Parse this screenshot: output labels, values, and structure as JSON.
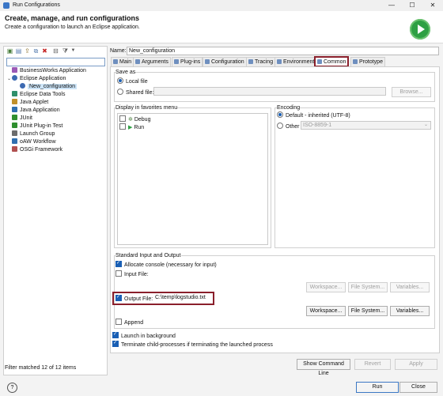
{
  "window": {
    "title": "Run Configurations",
    "minimize": "—",
    "maximize": "☐",
    "close": "✕"
  },
  "header": {
    "title": "Create, manage, and run configurations",
    "subtitle": "Create a configuration to launch an Eclipse application."
  },
  "tree": {
    "items": [
      {
        "label": "BusinessWorks Application",
        "color": "#9b59b6"
      },
      {
        "label": "Eclipse Application",
        "color": "#3d6ab2",
        "expanded": true
      },
      {
        "label": "New_configuration",
        "color": "#3d6ab2",
        "selected": true
      },
      {
        "label": "Eclipse Data Tools",
        "color": "#2f8f6a"
      },
      {
        "label": "Java Applet",
        "color": "#c0902a"
      },
      {
        "label": "Java Application",
        "color": "#2f6fb0"
      },
      {
        "label": "JUnit",
        "color": "#2f8f2f"
      },
      {
        "label": "JUnit Plug-in Test",
        "color": "#2f8f2f"
      },
      {
        "label": "Launch Group",
        "color": "#6c6c6c"
      },
      {
        "label": "oAW Workflow",
        "color": "#2f6fb0"
      },
      {
        "label": "OSGi Framework",
        "color": "#b05050"
      }
    ],
    "filter_status": "Filter matched 12 of 12 items"
  },
  "config": {
    "name_label": "Name:",
    "name_value": "New_configuration"
  },
  "tabs": [
    "Main",
    "Arguments",
    "Plug-ins",
    "Configuration",
    "Tracing",
    "Environment",
    "Common",
    "Prototype"
  ],
  "save_as": {
    "label": "Save as",
    "local": "Local file",
    "shared": "Shared file:",
    "browse": "Browse..."
  },
  "favorites": {
    "label": "Display in favorites menu",
    "items": [
      "Debug",
      "Run"
    ]
  },
  "encoding": {
    "label": "Encoding",
    "default": "Default - inherited (UTF-8)",
    "other": "Other",
    "other_value": "ISO-8859-1"
  },
  "stdio": {
    "label": "Standard Input and Output",
    "allocate": "Allocate console (necessary for input)",
    "input": "Input File:",
    "output": "Output File:",
    "output_value": "C:\\temp\\logstudio.txt",
    "workspace": "Workspace...",
    "filesystem": "File System...",
    "variables": "Variables...",
    "append": "Append"
  },
  "launch_bg": "Launch in background",
  "terminate_child": "Terminate child-processes if terminating the launched process",
  "buttons": {
    "show_cmd": "Show Command Line",
    "revert": "Revert",
    "apply": "Apply",
    "run": "Run",
    "close": "Close",
    "help": "?"
  }
}
